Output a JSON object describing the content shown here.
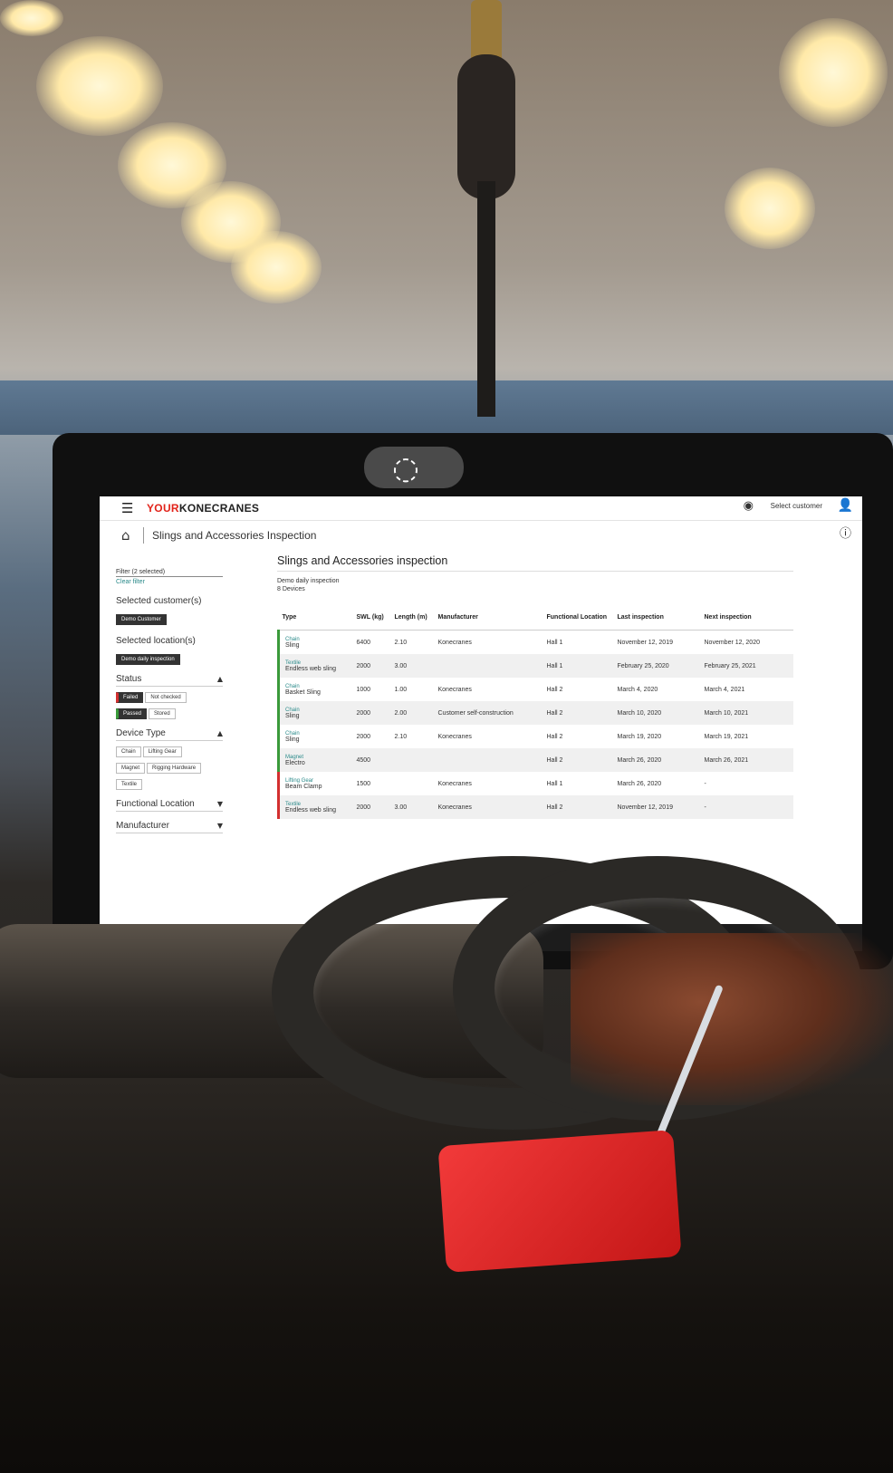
{
  "app": {
    "logo_part1": "YOUR",
    "logo_part2": "KONECRANES",
    "select_customer": "Select customer",
    "breadcrumb": "Slings and Accessories Inspection"
  },
  "icons": {
    "menu": "☰",
    "globe": "◉",
    "user": "👤",
    "home": "⌂",
    "info": "ⓘ",
    "camera": "◌",
    "up": "⏶"
  },
  "sidebar": {
    "filter_label": "Filter (2 selected)",
    "clear_filter": "Clear filter",
    "customers_title": "Selected customer(s)",
    "customers_chip": "Demo Customer",
    "locations_title": "Selected location(s)",
    "locations_chip": "Demo daily inspection",
    "status_title": "Status",
    "status_chips": [
      "Failed",
      "Not checked",
      "Passed",
      "Stored"
    ],
    "device_type_title": "Device Type",
    "device_chips": [
      "Chain",
      "Lifting Gear",
      "Magnet",
      "Rigging Hardware",
      "Textile"
    ],
    "functional_location_title": "Functional Location",
    "manufacturer_title": "Manufacturer"
  },
  "main": {
    "title": "Slings and Accessories inspection",
    "subtitle": "Demo daily inspection",
    "device_count": "8 Devices",
    "columns": [
      "Type",
      "SWL (kg)",
      "Length (m)",
      "Manufacturer",
      "Functional Location",
      "Last inspection",
      "Next inspection"
    ],
    "rows": [
      {
        "cat": "Chain",
        "name": "Sling",
        "swl": "6400",
        "length": "2.10",
        "mfr": "Konecranes",
        "loc": "Hall 1",
        "last": "November 12, 2019",
        "next": "November 12, 2020",
        "status": "green"
      },
      {
        "cat": "Textile",
        "name": "Endless web sling",
        "swl": "2000",
        "length": "3.00",
        "mfr": "",
        "loc": "Hall 1",
        "last": "February 25, 2020",
        "next": "February 25, 2021",
        "status": "green"
      },
      {
        "cat": "Chain",
        "name": "Basket Sling",
        "swl": "1000",
        "length": "1.00",
        "mfr": "Konecranes",
        "loc": "Hall 2",
        "last": "March 4, 2020",
        "next": "March 4, 2021",
        "status": "green"
      },
      {
        "cat": "Chain",
        "name": "Sling",
        "swl": "2000",
        "length": "2.00",
        "mfr": "Customer self-construction",
        "loc": "Hall 2",
        "last": "March 10, 2020",
        "next": "March 10, 2021",
        "status": "green"
      },
      {
        "cat": "Chain",
        "name": "Sling",
        "swl": "2000",
        "length": "2.10",
        "mfr": "Konecranes",
        "loc": "Hall 2",
        "last": "March 19, 2020",
        "next": "March 19, 2021",
        "status": "green"
      },
      {
        "cat": "Magnet",
        "name": "Electro",
        "swl": "4500",
        "length": "",
        "mfr": "",
        "loc": "Hall 2",
        "last": "March 26, 2020",
        "next": "March 26, 2021",
        "status": "green"
      },
      {
        "cat": "Lifting Gear",
        "name": "Beam Clamp",
        "swl": "1500",
        "length": "",
        "mfr": "Konecranes",
        "loc": "Hall 1",
        "last": "March 26, 2020",
        "next": "-",
        "status": "red"
      },
      {
        "cat": "Textile",
        "name": "Endless web sling",
        "swl": "2000",
        "length": "3.00",
        "mfr": "Konecranes",
        "loc": "Hall 2",
        "last": "November 12, 2019",
        "next": "-",
        "status": "red"
      }
    ]
  },
  "colors": {
    "brand_red": "#e2231a",
    "passed_green": "#3a9a3a",
    "failed_red": "#d32f2f",
    "link_teal": "#2a8a8a"
  }
}
